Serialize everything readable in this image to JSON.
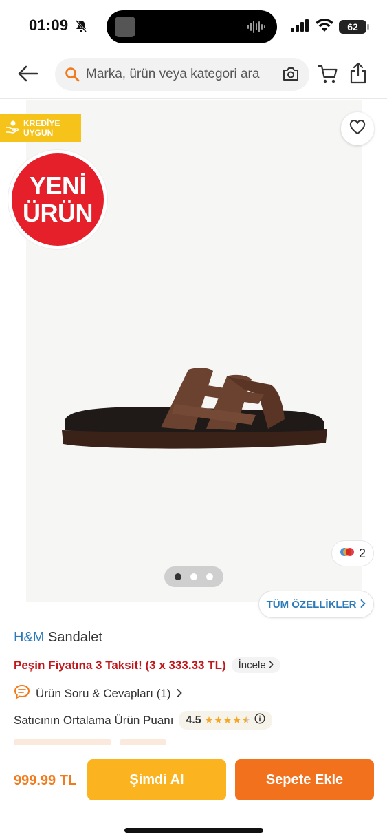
{
  "status_bar": {
    "time": "01:09",
    "battery": "62",
    "icons": [
      "bell-off-icon",
      "audio-wave-icon",
      "signal-icon",
      "wifi-icon",
      "battery-icon"
    ]
  },
  "nav": {
    "search_placeholder": "Marka, ürün veya kategori ara",
    "icons": [
      "back-arrow-icon",
      "search-icon",
      "camera-icon",
      "cart-icon",
      "share-icon"
    ]
  },
  "gallery": {
    "credit_badge_line1": "KREDİYE",
    "credit_badge_line2": "UYGUN",
    "new_badge_line1": "YENİ",
    "new_badge_line2": "ÜRÜN",
    "color_count": "2",
    "image_count": 3,
    "active_index": 0,
    "features_label": "TÜM ÖZELLİKLER"
  },
  "product": {
    "brand": "H&M",
    "name": "Sandalet",
    "installment_text": "Peşin Fiyatına 3 Taksit! (3 x 333.33 TL)",
    "installment_link": "İncele",
    "qa_label": "Ürün Soru & Cevapları (1)",
    "seller_rating_label": "Satıcının Ortalama Ürün Puanı",
    "seller_rating_value": "4.5",
    "seller_rating_stars": 4.5
  },
  "bottom_bar": {
    "price": "999.99 TL",
    "buy_now_label": "Şimdi Al",
    "add_to_cart_label": "Sepete Ekle"
  },
  "colors": {
    "accent_orange": "#f2711c",
    "accent_yellow": "#fbb31f",
    "brand_blue": "#2c7ab8",
    "installment_red": "#c0171c",
    "badge_red": "#e5202a",
    "credit_yellow": "#f6c31b"
  }
}
